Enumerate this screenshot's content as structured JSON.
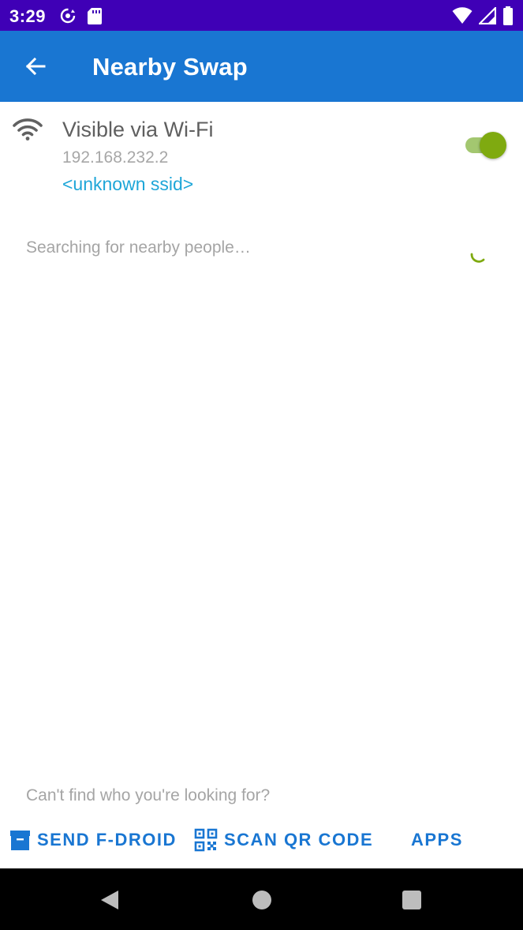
{
  "status_bar": {
    "time": "3:29",
    "icons": [
      "sync-icon",
      "sd-card-icon",
      "wifi-signal-icon",
      "cell-signal-icon",
      "battery-icon"
    ]
  },
  "app_bar": {
    "title": "Nearby Swap",
    "back_icon": "arrow-back-icon"
  },
  "wifi": {
    "title": "Visible via Wi-Fi",
    "ip": "192.168.232.2",
    "ssid": "<unknown ssid>",
    "enabled": true
  },
  "search": {
    "status": "Searching for nearby people…"
  },
  "footer": {
    "hint": "Can't find who you're looking for?",
    "send_label": "SEND F-DROID",
    "scan_label": "SCAN QR CODE",
    "apps_label": "APPS"
  },
  "colors": {
    "status_bar": "#3f00b6",
    "app_bar": "#1976d2",
    "accent": "#7faa10",
    "link": "#1ea6d8"
  }
}
